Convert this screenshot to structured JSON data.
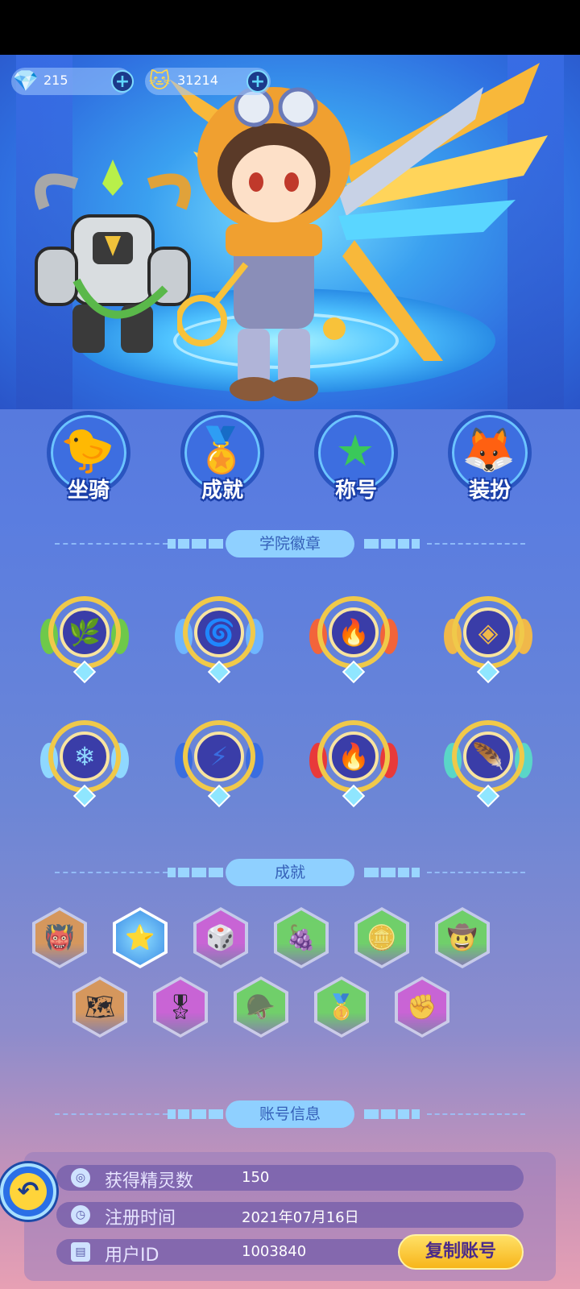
{
  "currencies": [
    {
      "name": "diamond",
      "icon": "heart-gem-icon",
      "value": "215",
      "color": "#7fdcff"
    },
    {
      "name": "coin",
      "icon": "cat-coin-icon",
      "value": "31214",
      "color": "#ffd54a"
    }
  ],
  "menu": [
    {
      "label": "坐骑",
      "icon": "duck-icon"
    },
    {
      "label": "成就",
      "icon": "medal-icon"
    },
    {
      "label": "称号",
      "icon": "star-shield-icon"
    },
    {
      "label": "装扮",
      "icon": "fox-sweater-icon"
    }
  ],
  "sections": {
    "badges_title": "学院徽章",
    "achievements_title": "成就",
    "account_title": "账号信息"
  },
  "badges": [
    {
      "icon": "leaf-icon",
      "glyph": "🌿",
      "color": "#6ec94a"
    },
    {
      "icon": "wind-icon",
      "glyph": "🌀",
      "color": "#6fb6ff"
    },
    {
      "icon": "fire-icon",
      "glyph": "🔥",
      "color": "#f2643a"
    },
    {
      "icon": "earth-icon",
      "glyph": "◈",
      "color": "#f0b84a"
    },
    {
      "icon": "snowflake-icon",
      "glyph": "❄",
      "color": "#8fd8ff"
    },
    {
      "icon": "lightning-icon",
      "glyph": "⚡",
      "color": "#3a6de0"
    },
    {
      "icon": "flame-crest-icon",
      "glyph": "🔥",
      "color": "#e83a3a"
    },
    {
      "icon": "wing-icon",
      "glyph": "🪶",
      "color": "#5ad6c8"
    }
  ],
  "achievements": [
    {
      "icon": "demon-helmet-icon",
      "glyph": "👹",
      "color": "#d98a3a",
      "locked": true
    },
    {
      "icon": "crown-star-icon",
      "glyph": "⭐",
      "color": "#6ad0ff",
      "locked": false
    },
    {
      "icon": "dice-icon",
      "glyph": "🎲",
      "color": "#c84ad0",
      "locked": true
    },
    {
      "icon": "fruit-icon",
      "glyph": "🍇",
      "color": "#5ad04a",
      "locked": true
    },
    {
      "icon": "coin-icon",
      "glyph": "🪙",
      "color": "#5ad04a",
      "locked": true
    },
    {
      "icon": "cowboy-icon",
      "glyph": "🤠",
      "color": "#5ad04a",
      "locked": true
    },
    {
      "icon": "map-icon",
      "glyph": "🗺",
      "color": "#d98a3a",
      "locked": true
    },
    {
      "icon": "winged-medal-icon",
      "glyph": "🎖",
      "color": "#c84ad0",
      "locked": true
    },
    {
      "icon": "soldier-icon",
      "glyph": "🪖",
      "color": "#5ad04a",
      "locked": true
    },
    {
      "icon": "rank-one-icon",
      "glyph": "🥇",
      "color": "#5ad04a",
      "locked": true
    },
    {
      "icon": "fist-icon",
      "glyph": "✊",
      "color": "#c84ad0",
      "locked": true
    }
  ],
  "account": {
    "rows": [
      {
        "label": "获得精灵数",
        "value": "150",
        "icon": "pokeball-icon"
      },
      {
        "label": "注册时间",
        "value": "2021年07月16日",
        "icon": "clock-icon"
      },
      {
        "label": "用户ID",
        "value": "1003840",
        "icon": "id-card-icon"
      }
    ],
    "copy_label": "复制账号"
  },
  "back_label": "back"
}
